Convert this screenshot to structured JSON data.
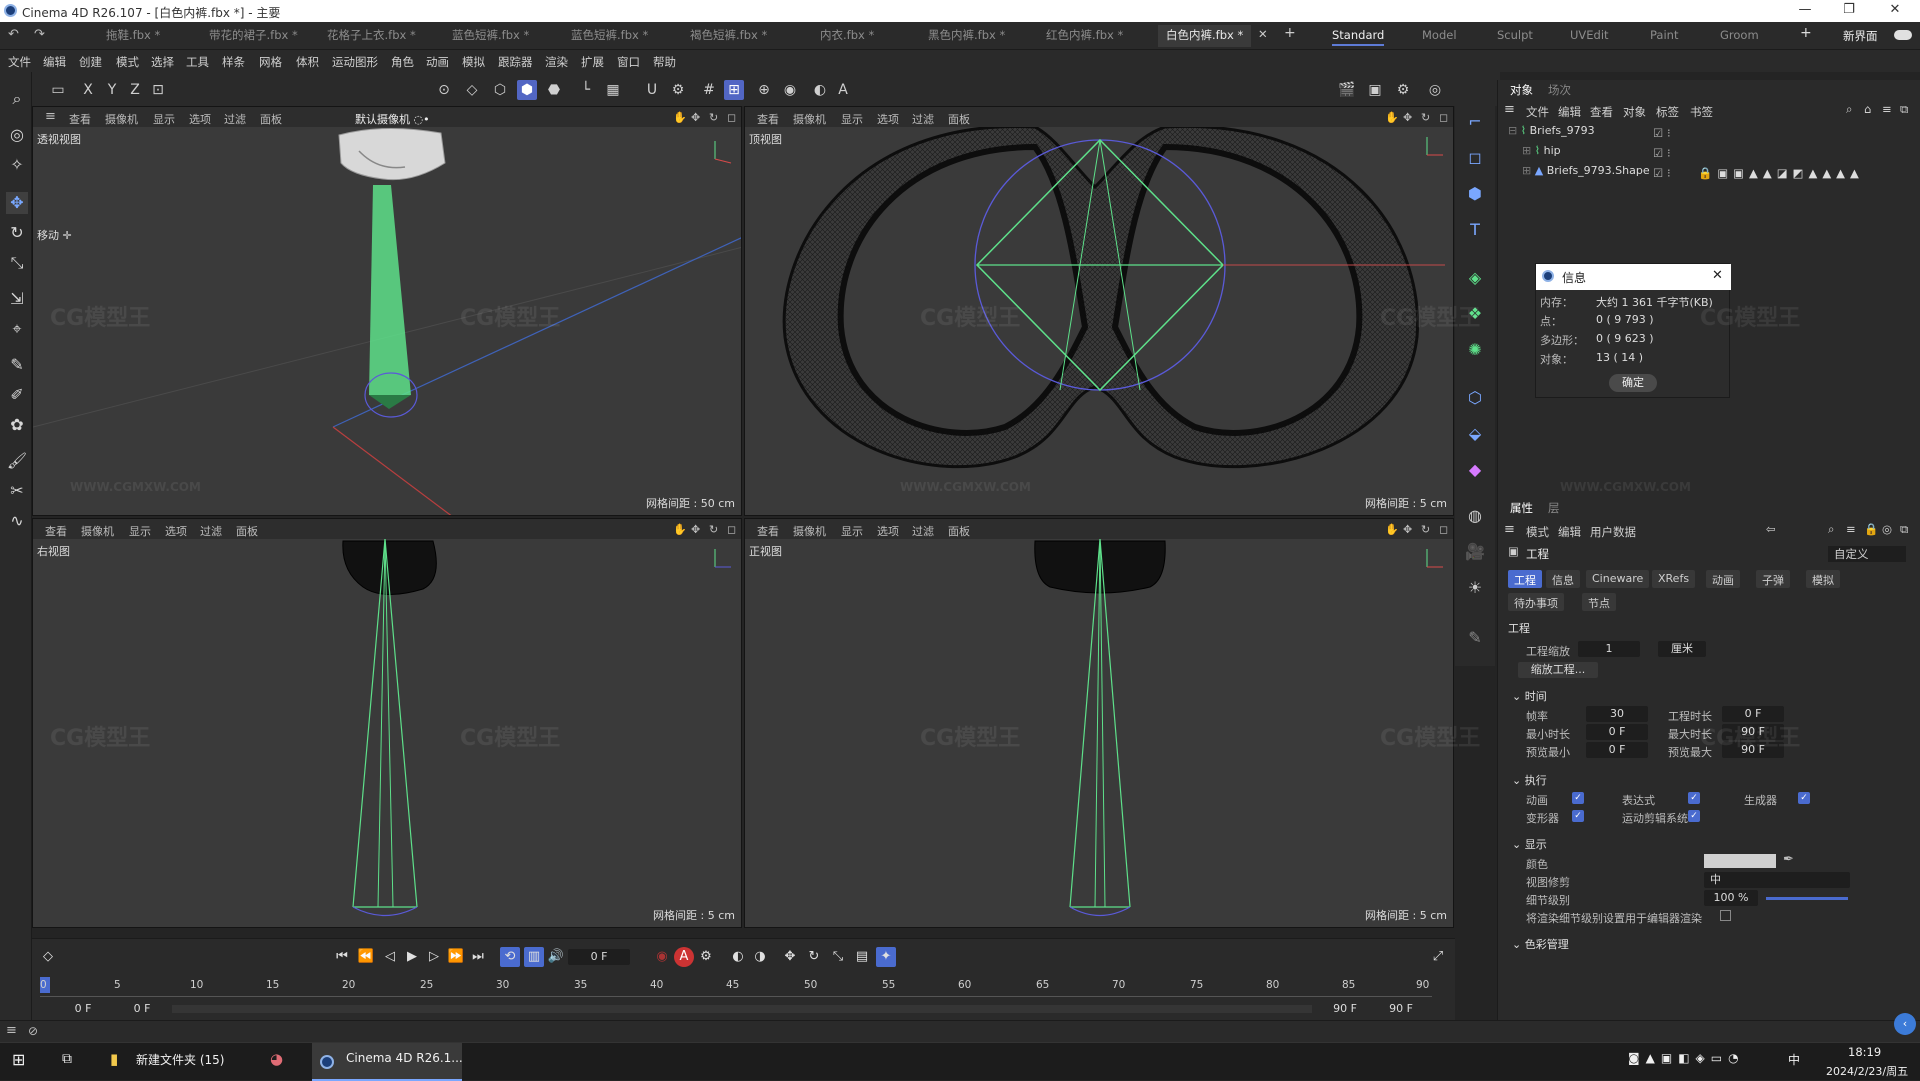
{
  "window": {
    "title": "Cinema 4D R26.107 - [白色内裤.fbx *] - 主要",
    "min": "—",
    "max": "❐",
    "close": "✕"
  },
  "doc_tabs": [
    {
      "label": "拖鞋.fbx *"
    },
    {
      "label": "带花的裙子.fbx *"
    },
    {
      "label": "花格子上衣.fbx *"
    },
    {
      "label": "蓝色短裤.fbx *"
    },
    {
      "label": "蓝色短裤.fbx *"
    },
    {
      "label": "褐色短裤.fbx *"
    },
    {
      "label": "内衣.fbx *"
    },
    {
      "label": "黑色内裤.fbx *"
    },
    {
      "label": "红色内裤.fbx *"
    },
    {
      "label": "白色内裤.fbx *"
    }
  ],
  "layouts": [
    "Standard",
    "Model",
    "Sculpt",
    "UVEdit",
    "Paint",
    "Groom"
  ],
  "new_layout": "新界面",
  "menu": [
    "文件",
    "编辑",
    "创建",
    "模式",
    "选择",
    "工具",
    "样条",
    "网格",
    "体积",
    "运动图形",
    "角色",
    "动画",
    "模拟",
    "跟踪器",
    "渲染",
    "扩展",
    "窗口",
    "帮助"
  ],
  "viewport_menu": [
    "查看",
    "摄像机",
    "显示",
    "选项",
    "过滤",
    "面板"
  ],
  "viewports": {
    "perspective": {
      "name": "透视视图",
      "camera": "默认摄像机 ◌•",
      "grid": "网格间距 : 50 cm",
      "mode": "移动 ✛"
    },
    "top": {
      "name": "顶视图",
      "grid": "网格间距 : 5 cm"
    },
    "right": {
      "name": "右视图",
      "grid": "网格间距 : 5 cm"
    },
    "front": {
      "name": "正视图",
      "grid": "网格间距 : 5 cm"
    }
  },
  "object_panel": {
    "tabs": [
      "对象",
      "场次"
    ],
    "menu": [
      "文件",
      "编辑",
      "查看",
      "对象",
      "标签",
      "书签"
    ],
    "objects": [
      {
        "name": "Briefs_9793"
      },
      {
        "name": "hip"
      },
      {
        "name": "Briefs_9793.Shape"
      }
    ]
  },
  "info_dialog": {
    "title": "信息",
    "rows": [
      {
        "label": "内存：",
        "value": "大约 1 361 千字节(KB)"
      },
      {
        "label": "点：",
        "value": "0 ( 9 793 )"
      },
      {
        "label": "多边形：",
        "value": "0 ( 9 623 )"
      },
      {
        "label": "对象：",
        "value": "13 ( 14 )"
      }
    ],
    "ok": "确定"
  },
  "attributes": {
    "tabs": [
      "属性",
      "层"
    ],
    "menu": [
      "模式",
      "编辑",
      "用户数据"
    ],
    "title": "工程",
    "preset": "自定义",
    "subtabs": [
      "工程",
      "信息",
      "Cineware",
      "XRefs",
      "动画",
      "子弹",
      "模拟"
    ],
    "subtabs2": [
      "待办事项",
      "节点"
    ],
    "section": "工程",
    "scale_label": "工程缩放",
    "scale_value": "1",
    "scale_unit": "厘米",
    "scale_btn": "缩放工程...",
    "time_section": "时间",
    "fps_label": "帧率",
    "fps_value": "30",
    "duration_label": "工程时长",
    "duration_value": "0 F",
    "min_label": "最小时长",
    "min_value": "0 F",
    "max_label": "最大时长",
    "max_value": "90 F",
    "pmin_label": "预览最小",
    "pmin_value": "0 F",
    "pmax_label": "预览最大",
    "pmax_value": "90 F",
    "exec_section": "执行",
    "exec": [
      {
        "label": "动画"
      },
      {
        "label": "表达式"
      },
      {
        "label": "生成器"
      },
      {
        "label": "变形器"
      },
      {
        "label": "运动剪辑系统"
      }
    ],
    "display_section": "显示",
    "color_label": "颜色",
    "lod_label": "视图修剪",
    "lod_value": "中",
    "detail_label": "细节级别",
    "detail_value": "100 %",
    "render_lod_label": "将渲染细节级别设置用于编辑器渲染",
    "color_mgmt": "色彩管理"
  },
  "timeline": {
    "frame": "0 F",
    "ticks": [
      "0",
      "5",
      "10",
      "15",
      "20",
      "25",
      "30",
      "35",
      "40",
      "45",
      "50",
      "55",
      "60",
      "65",
      "70",
      "75",
      "80",
      "85",
      "90"
    ],
    "start": "0 F",
    "start2": "0 F",
    "end": "90 F",
    "end2": "90 F"
  },
  "taskbar": {
    "folder": "新建文件夹 (15)",
    "app": "Cinema 4D R26.1...",
    "time": "18:19",
    "date": "2024/2/23/周五",
    "ime": "中"
  },
  "watermark": "CG模型王",
  "watermark_url": "WWW.CGMXW.COM",
  "colors": {
    "accent": "#4a6bcf",
    "green": "#5ee08a",
    "mesh": "#0d0d0d"
  }
}
